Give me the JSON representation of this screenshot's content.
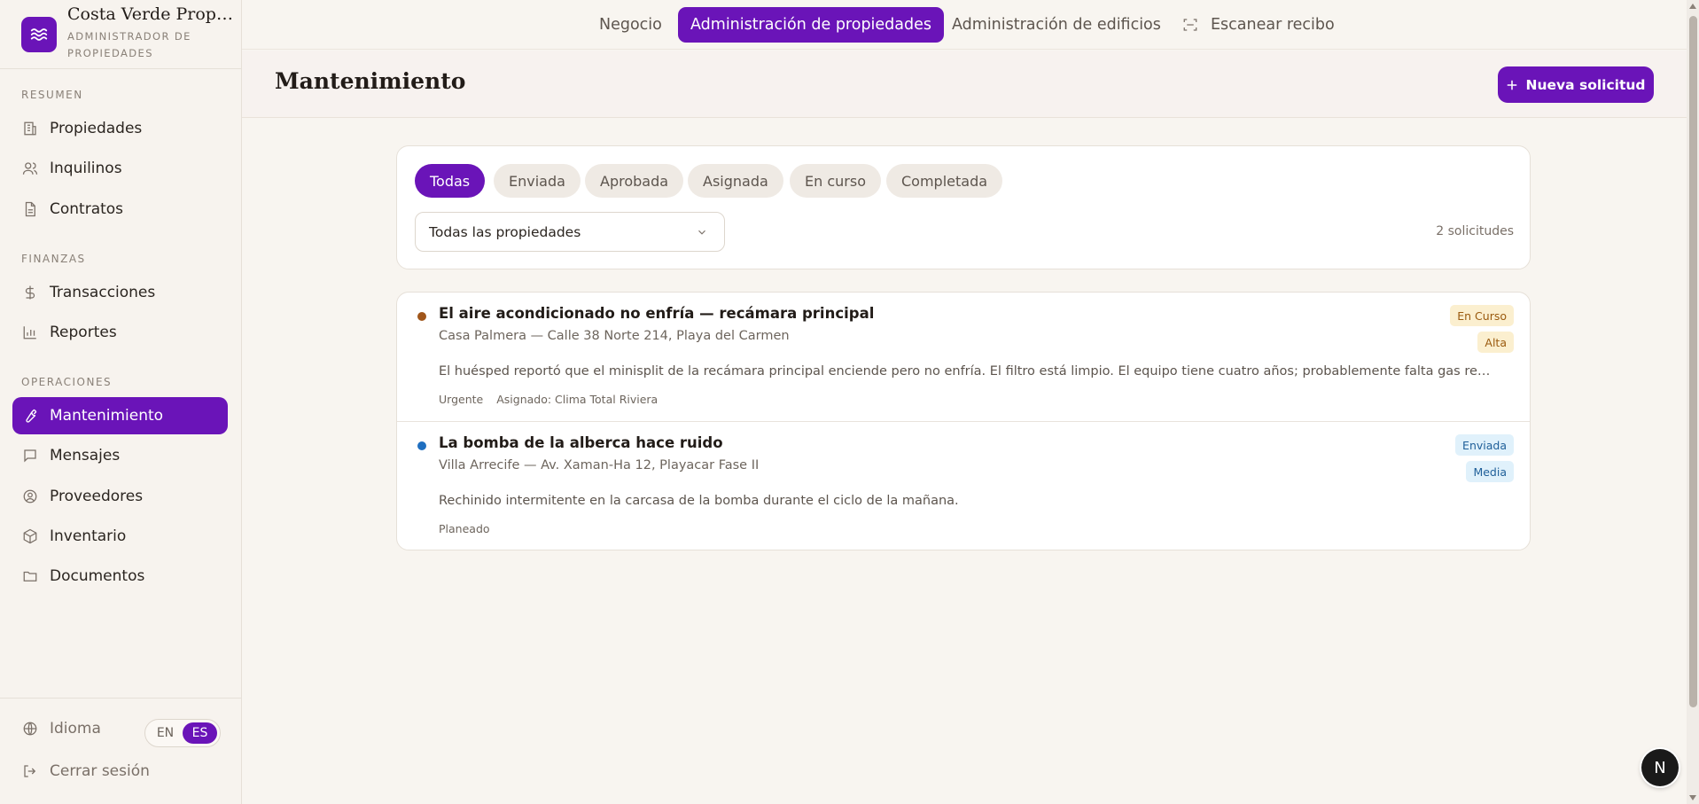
{
  "brand": {
    "name": "Costa Verde Properties",
    "subtitle": "Administrador de propiedades"
  },
  "sidebar": {
    "sections": [
      {
        "label": "RESUMEN",
        "items": [
          {
            "label": "Propiedades",
            "icon": "building-icon"
          },
          {
            "label": "Inquilinos",
            "icon": "users-icon"
          },
          {
            "label": "Contratos",
            "icon": "document-icon"
          }
        ]
      },
      {
        "label": "FINANZAS",
        "items": [
          {
            "label": "Transacciones",
            "icon": "dollar-icon"
          },
          {
            "label": "Reportes",
            "icon": "bar-chart-icon"
          }
        ]
      },
      {
        "label": "OPERACIONES",
        "items": [
          {
            "label": "Mantenimiento",
            "icon": "wrench-icon",
            "active": true
          },
          {
            "label": "Mensajes",
            "icon": "message-icon"
          },
          {
            "label": "Proveedores",
            "icon": "user-circle-icon"
          },
          {
            "label": "Inventario",
            "icon": "package-icon"
          },
          {
            "label": "Documentos",
            "icon": "folder-icon"
          }
        ]
      }
    ],
    "language": {
      "label": "Idioma",
      "options": [
        "EN",
        "ES"
      ],
      "selected": "ES"
    },
    "logout": "Cerrar sesión"
  },
  "topnav": {
    "tabs": [
      "Negocio",
      "Administración de propiedades",
      "Administración de edificios",
      "Escanear recibo"
    ],
    "active": "Administración de propiedades"
  },
  "header": {
    "title": "Mantenimiento",
    "new_button": "Nueva solicitud"
  },
  "filters": {
    "chips": [
      "Todas",
      "Enviada",
      "Aprobada",
      "Asignada",
      "En curso",
      "Completada"
    ],
    "active": "Todas",
    "property_select": "Todas las propiedades",
    "count": "2 solicitudes"
  },
  "requests": [
    {
      "title": "El aire acondicionado no enfría — recámara principal",
      "location": "Casa Palmera — Calle 38 Norte 214, Playa del Carmen",
      "description": "El huésped reportó que el minisplit de la recámara principal enciende pero no enfría. El filtro está limpio. El equipo tiene cuatro años; probablemente falta gas refrigerante o el compresor está fallando.",
      "meta": [
        "Urgente",
        "Asignado: Clima Total Riviera"
      ],
      "status": "En Curso",
      "priority": "Alta",
      "dot_color": "#a0561a"
    },
    {
      "title": "La bomba de la alberca hace ruido",
      "location": "Villa Arrecife — Av. Xaman-Ha 12, Playacar Fase II",
      "description": "Rechinido intermitente en la carcasa de la bomba durante el ciclo de la mañana.",
      "meta": [
        "Planeado"
      ],
      "status": "Enviada",
      "priority": "Media",
      "dot_color": "#1f6fc0"
    }
  ],
  "fab_label": "N",
  "colors": {
    "accent": "#6a14b8",
    "background": "#f8f5f0"
  }
}
